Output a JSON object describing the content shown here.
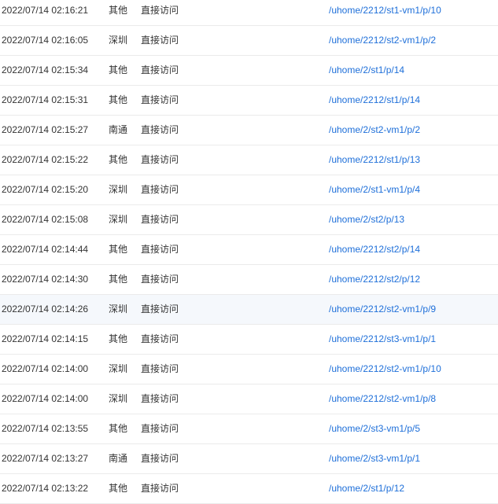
{
  "visit_log": {
    "rows": [
      {
        "time": "2022/07/14 02:16:21",
        "region": "其他",
        "source": "直接访问",
        "url": "/uhome/2212/st1-vm1/p/10"
      },
      {
        "time": "2022/07/14 02:16:05",
        "region": "深圳",
        "source": "直接访问",
        "url": "/uhome/2212/st2-vm1/p/2"
      },
      {
        "time": "2022/07/14 02:15:34",
        "region": "其他",
        "source": "直接访问",
        "url": "/uhome/2/st1/p/14"
      },
      {
        "time": "2022/07/14 02:15:31",
        "region": "其他",
        "source": "直接访问",
        "url": "/uhome/2212/st1/p/14"
      },
      {
        "time": "2022/07/14 02:15:27",
        "region": "南通",
        "source": "直接访问",
        "url": "/uhome/2/st2-vm1/p/2"
      },
      {
        "time": "2022/07/14 02:15:22",
        "region": "其他",
        "source": "直接访问",
        "url": "/uhome/2212/st1/p/13"
      },
      {
        "time": "2022/07/14 02:15:20",
        "region": "深圳",
        "source": "直接访问",
        "url": "/uhome/2/st1-vm1/p/4"
      },
      {
        "time": "2022/07/14 02:15:08",
        "region": "深圳",
        "source": "直接访问",
        "url": "/uhome/2/st2/p/13"
      },
      {
        "time": "2022/07/14 02:14:44",
        "region": "其他",
        "source": "直接访问",
        "url": "/uhome/2212/st2/p/14"
      },
      {
        "time": "2022/07/14 02:14:30",
        "region": "其他",
        "source": "直接访问",
        "url": "/uhome/2212/st2/p/12"
      },
      {
        "time": "2022/07/14 02:14:26",
        "region": "深圳",
        "source": "直接访问",
        "url": "/uhome/2212/st2-vm1/p/9"
      },
      {
        "time": "2022/07/14 02:14:15",
        "region": "其他",
        "source": "直接访问",
        "url": "/uhome/2212/st3-vm1/p/1"
      },
      {
        "time": "2022/07/14 02:14:00",
        "region": "深圳",
        "source": "直接访问",
        "url": "/uhome/2212/st2-vm1/p/10"
      },
      {
        "time": "2022/07/14 02:14:00",
        "region": "深圳",
        "source": "直接访问",
        "url": "/uhome/2212/st2-vm1/p/8"
      },
      {
        "time": "2022/07/14 02:13:55",
        "region": "其他",
        "source": "直接访问",
        "url": "/uhome/2/st3-vm1/p/5"
      },
      {
        "time": "2022/07/14 02:13:27",
        "region": "南通",
        "source": "直接访问",
        "url": "/uhome/2/st3-vm1/p/1"
      },
      {
        "time": "2022/07/14 02:13:22",
        "region": "其他",
        "source": "直接访问",
        "url": "/uhome/2/st1/p/12"
      }
    ]
  },
  "colors": {
    "text": "#333333",
    "link": "#1e6fd9",
    "row_divider": "#ebebeb",
    "hover_row_background": "#f5f8fc"
  }
}
